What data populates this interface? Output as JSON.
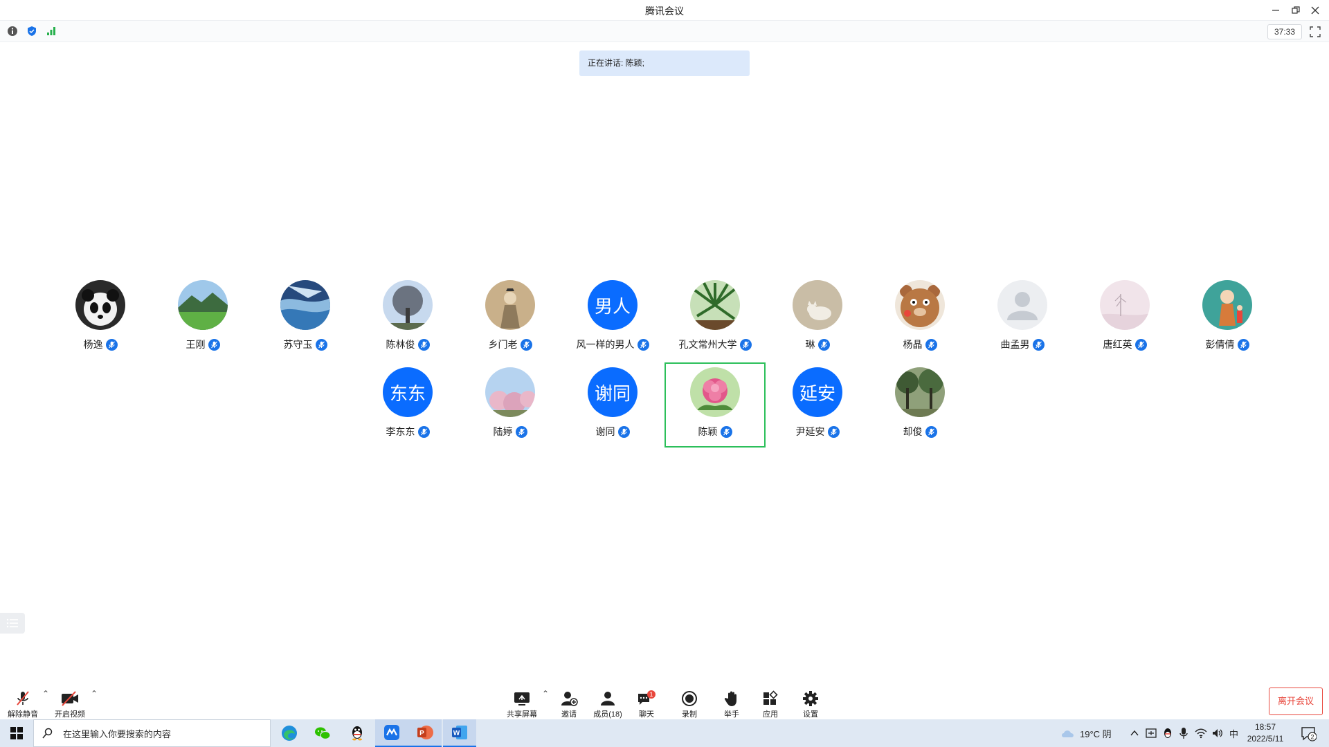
{
  "window": {
    "title": "腾讯会议"
  },
  "infobar": {
    "timer": "37:33"
  },
  "speaking": {
    "text": "正在讲话: 陈颖;"
  },
  "participants": [
    {
      "name": "杨逸",
      "avatar_text": "",
      "avatar_type": "panda"
    },
    {
      "name": "王刚",
      "avatar_text": "",
      "avatar_type": "mountain"
    },
    {
      "name": "苏守玉",
      "avatar_text": "",
      "avatar_type": "sea"
    },
    {
      "name": "陈林俊",
      "avatar_text": "",
      "avatar_type": "tree"
    },
    {
      "name": "乡门老",
      "avatar_text": "",
      "avatar_type": "painting"
    },
    {
      "name": "风一样的男人",
      "avatar_text": "男人",
      "avatar_type": "text"
    },
    {
      "name": "孔文常州大学",
      "avatar_text": "",
      "avatar_type": "palm"
    },
    {
      "name": "琳",
      "avatar_text": "",
      "avatar_type": "cat"
    },
    {
      "name": "杨晶",
      "avatar_text": "",
      "avatar_type": "bear"
    },
    {
      "name": "曲孟男",
      "avatar_text": "",
      "avatar_type": "default"
    },
    {
      "name": "唐红英",
      "avatar_text": "",
      "avatar_type": "misty"
    },
    {
      "name": "彭倩倩",
      "avatar_text": "",
      "avatar_type": "cartoon"
    },
    {
      "name": "李东东",
      "avatar_text": "东东",
      "avatar_type": "text"
    },
    {
      "name": "陆婷",
      "avatar_text": "",
      "avatar_type": "blossom"
    },
    {
      "name": "谢同",
      "avatar_text": "谢同",
      "avatar_type": "text"
    },
    {
      "name": "陈颖",
      "avatar_text": "",
      "avatar_type": "flower"
    },
    {
      "name": "尹延安",
      "avatar_text": "延安",
      "avatar_type": "text"
    },
    {
      "name": "却俊",
      "avatar_text": "",
      "avatar_type": "forest"
    }
  ],
  "toolbar": {
    "unmute": "解除静音",
    "start_video": "开启视频",
    "share_screen": "共享屏幕",
    "invite": "邀请",
    "members": "成员(18)",
    "chat": "聊天",
    "chat_badge": "1",
    "record": "录制",
    "raise_hand": "举手",
    "apps": "应用",
    "settings": "设置",
    "leave": "离开会议"
  },
  "taskbar": {
    "search_placeholder": "在这里输入你要搜索的内容",
    "weather": "19°C  阴",
    "ime": "中",
    "time": "18:57",
    "date": "2022/5/11",
    "notifications": "2"
  }
}
